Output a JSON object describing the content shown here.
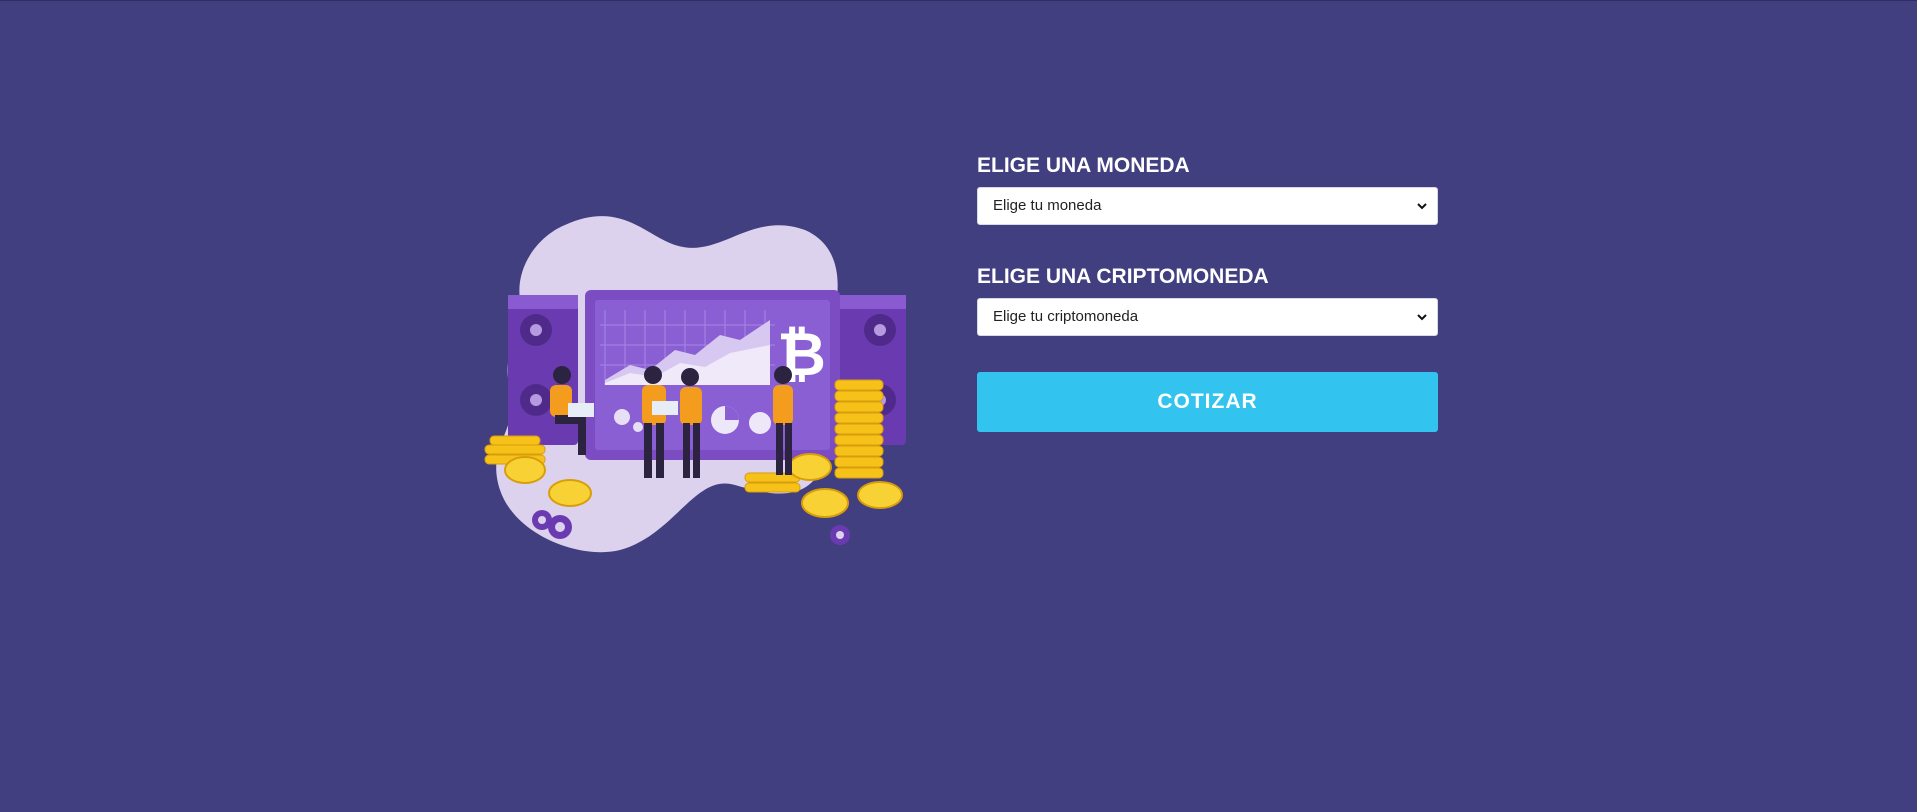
{
  "form": {
    "currency_label": "ELIGE UNA MONEDA",
    "currency_select": {
      "selected": "Elige tu moneda"
    },
    "crypto_label": "ELIGE UNA CRIPTOMONEDA",
    "crypto_select": {
      "selected": "Elige tu criptomoneda"
    },
    "submit_label": "COTIZAR"
  },
  "illustration": {
    "icon": "bitcoin-mining-illustration"
  },
  "colors": {
    "background": "#413f80",
    "accent": "#33c3ef",
    "text": "#ffffff"
  }
}
